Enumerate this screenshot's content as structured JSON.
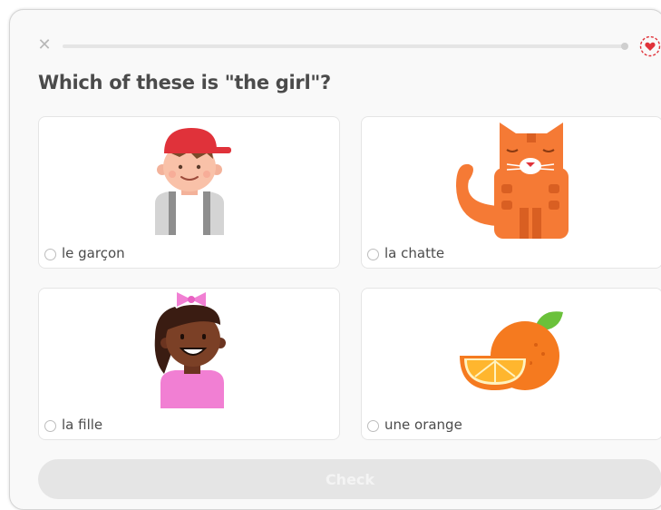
{
  "header": {
    "close_icon": "close-icon",
    "progress": 0.0,
    "hearts_icon": "heart-icon",
    "question": "Which of these is \"the girl\"?"
  },
  "options": [
    {
      "label": "le garçon",
      "icon": "boy-icon"
    },
    {
      "label": "la chatte",
      "icon": "cat-icon"
    },
    {
      "label": "la fille",
      "icon": "girl-icon"
    },
    {
      "label": "une orange",
      "icon": "orange-icon"
    }
  ],
  "footer": {
    "check_label": "Check"
  },
  "colors": {
    "accent_red": "#e0323a",
    "button_disabled": "#e5e5e5"
  }
}
